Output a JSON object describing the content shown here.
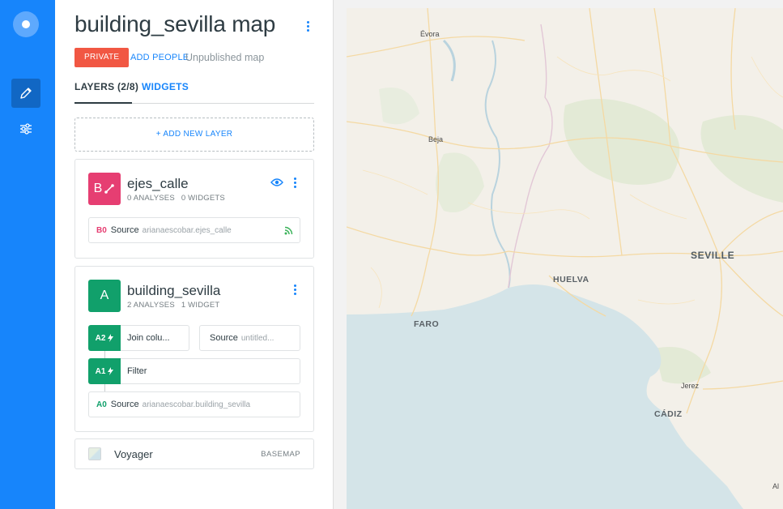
{
  "app": {
    "map_title": "building_sevilla map",
    "privacy_label": "PRIVATE",
    "add_people_label": "ADD PEOPLE",
    "publish_status": "Unpublished map"
  },
  "tabs": [
    {
      "label": "LAYERS (2/8)",
      "active": true
    },
    {
      "label": "WIDGETS",
      "active": false
    }
  ],
  "add_layer_label": "+ ADD NEW LAYER",
  "layers": [
    {
      "letter": "B",
      "name": "ejes_calle",
      "analyses": "0 ANALYSES",
      "widgets": "0 WIDGETS",
      "color": "#e63e72",
      "nodes": [
        {
          "id": "B0",
          "type": "Source",
          "value": "arianaescobar.ejes_calle"
        }
      ]
    },
    {
      "letter": "A",
      "name": "building_sevilla",
      "analyses": "2 ANALYSES",
      "widgets": "1 WIDGET",
      "color": "#11a06b",
      "nodes": [
        {
          "id": "A2",
          "label": "Join colu..."
        },
        {
          "id": "",
          "type": "Source",
          "value": "untitled..."
        },
        {
          "id": "A1",
          "label": "Filter"
        },
        {
          "id": "A0",
          "type": "Source",
          "value": "arianaescobar.building_sevilla"
        }
      ]
    }
  ],
  "basemap": {
    "name": "Voyager",
    "tag": "BASEMAP"
  },
  "map": {
    "places": [
      "Évora",
      "Beja",
      "SEVILLE",
      "HUELVA",
      "FARO",
      "Jerez",
      "CÁDIZ",
      "Al"
    ]
  },
  "colors": {
    "nav": "#1785fb",
    "accent": "#1785fb",
    "private": "#f15743",
    "layer_b": "#e63e72",
    "layer_a": "#11a06b",
    "sea": "#d4e4e8",
    "land": "#f3f0e9"
  },
  "icons": {
    "nav_edit": "pencil-icon",
    "nav_style": "sliders-icon",
    "visibility": "eye-icon",
    "source_live": "rss-icon",
    "analysis": "lightning-icon"
  }
}
